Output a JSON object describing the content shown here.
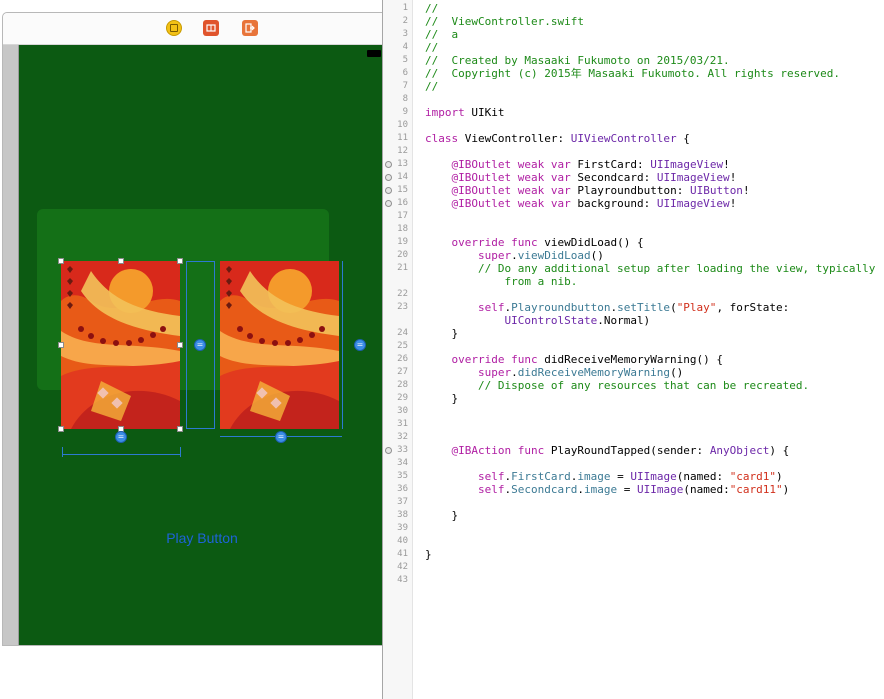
{
  "storyboard": {
    "play_button_label": "Play Button"
  },
  "editor": {
    "lines": [
      {
        "n": "1",
        "tokens": [
          [
            "c",
            "//"
          ]
        ]
      },
      {
        "n": "2",
        "tokens": [
          [
            "c",
            "//  ViewController.swift"
          ]
        ]
      },
      {
        "n": "3",
        "tokens": [
          [
            "c",
            "//  a"
          ]
        ]
      },
      {
        "n": "4",
        "tokens": [
          [
            "c",
            "//"
          ]
        ]
      },
      {
        "n": "5",
        "tokens": [
          [
            "c",
            "//  Created by Masaaki Fukumoto on 2015/03/21."
          ]
        ]
      },
      {
        "n": "6",
        "tokens": [
          [
            "c",
            "//  Copyright (c) 2015年 Masaaki Fukumoto. All rights reserved."
          ]
        ]
      },
      {
        "n": "7",
        "tokens": [
          [
            "c",
            "//"
          ]
        ]
      },
      {
        "n": "8",
        "tokens": []
      },
      {
        "n": "9",
        "tokens": [
          [
            "k",
            "import"
          ],
          [
            "p",
            " UIKit"
          ]
        ]
      },
      {
        "n": "10",
        "tokens": []
      },
      {
        "n": "11",
        "tokens": [
          [
            "k",
            "class"
          ],
          [
            "p",
            " ViewController: "
          ],
          [
            "t",
            "UIViewController"
          ],
          [
            "p",
            " {"
          ]
        ]
      },
      {
        "n": "12",
        "tokens": []
      },
      {
        "n": "13",
        "conn": true,
        "tokens": [
          [
            "p",
            "    "
          ],
          [
            "k",
            "@IBOutlet"
          ],
          [
            "p",
            " "
          ],
          [
            "k",
            "weak"
          ],
          [
            "p",
            " "
          ],
          [
            "k",
            "var"
          ],
          [
            "p",
            " FirstCard: "
          ],
          [
            "t",
            "UIImageView"
          ],
          [
            "p",
            "!"
          ]
        ]
      },
      {
        "n": "14",
        "conn": true,
        "tokens": [
          [
            "p",
            "    "
          ],
          [
            "k",
            "@IBOutlet"
          ],
          [
            "p",
            " "
          ],
          [
            "k",
            "weak"
          ],
          [
            "p",
            " "
          ],
          [
            "k",
            "var"
          ],
          [
            "p",
            " Secondcard: "
          ],
          [
            "t",
            "UIImageView"
          ],
          [
            "p",
            "!"
          ]
        ]
      },
      {
        "n": "15",
        "conn": true,
        "tokens": [
          [
            "p",
            "    "
          ],
          [
            "k",
            "@IBOutlet"
          ],
          [
            "p",
            " "
          ],
          [
            "k",
            "weak"
          ],
          [
            "p",
            " "
          ],
          [
            "k",
            "var"
          ],
          [
            "p",
            " Playroundbutton: "
          ],
          [
            "t",
            "UIButton"
          ],
          [
            "p",
            "!"
          ]
        ]
      },
      {
        "n": "16",
        "conn": true,
        "tokens": [
          [
            "p",
            "    "
          ],
          [
            "k",
            "@IBOutlet"
          ],
          [
            "p",
            " "
          ],
          [
            "k",
            "weak"
          ],
          [
            "p",
            " "
          ],
          [
            "k",
            "var"
          ],
          [
            "p",
            " background: "
          ],
          [
            "t",
            "UIImageView"
          ],
          [
            "p",
            "!"
          ]
        ]
      },
      {
        "n": "17",
        "tokens": []
      },
      {
        "n": "18",
        "tokens": []
      },
      {
        "n": "19",
        "tokens": [
          [
            "p",
            "    "
          ],
          [
            "k",
            "override"
          ],
          [
            "p",
            " "
          ],
          [
            "k",
            "func"
          ],
          [
            "p",
            " viewDidLoad() {"
          ]
        ]
      },
      {
        "n": "20",
        "tokens": [
          [
            "p",
            "        "
          ],
          [
            "k",
            "super"
          ],
          [
            "p",
            "."
          ],
          [
            "m",
            "viewDidLoad"
          ],
          [
            "p",
            "()"
          ]
        ]
      },
      {
        "n": "21",
        "tokens": [
          [
            "p",
            "        "
          ],
          [
            "c",
            "// Do any additional setup after loading the view, typically"
          ]
        ]
      },
      {
        "n": "",
        "tokens": [
          [
            "p",
            "            "
          ],
          [
            "c",
            "from a nib."
          ]
        ]
      },
      {
        "n": "22",
        "tokens": []
      },
      {
        "n": "23",
        "tokens": [
          [
            "p",
            "        "
          ],
          [
            "k",
            "self"
          ],
          [
            "p",
            "."
          ],
          [
            "m",
            "Playroundbutton"
          ],
          [
            "p",
            "."
          ],
          [
            "m",
            "setTitle"
          ],
          [
            "p",
            "("
          ],
          [
            "s",
            "\"Play\""
          ],
          [
            "p",
            ", forState:"
          ]
        ]
      },
      {
        "n": "",
        "tokens": [
          [
            "p",
            "            "
          ],
          [
            "t",
            "UIControlState"
          ],
          [
            "p",
            ".Normal)"
          ]
        ]
      },
      {
        "n": "24",
        "tokens": [
          [
            "p",
            "    }"
          ]
        ]
      },
      {
        "n": "25",
        "tokens": []
      },
      {
        "n": "26",
        "tokens": [
          [
            "p",
            "    "
          ],
          [
            "k",
            "override"
          ],
          [
            "p",
            " "
          ],
          [
            "k",
            "func"
          ],
          [
            "p",
            " didReceiveMemoryWarning() {"
          ]
        ]
      },
      {
        "n": "27",
        "tokens": [
          [
            "p",
            "        "
          ],
          [
            "k",
            "super"
          ],
          [
            "p",
            "."
          ],
          [
            "m",
            "didReceiveMemoryWarning"
          ],
          [
            "p",
            "()"
          ]
        ]
      },
      {
        "n": "28",
        "tokens": [
          [
            "p",
            "        "
          ],
          [
            "c",
            "// Dispose of any resources that can be recreated."
          ]
        ]
      },
      {
        "n": "29",
        "tokens": [
          [
            "p",
            "    }"
          ]
        ]
      },
      {
        "n": "30",
        "tokens": []
      },
      {
        "n": "31",
        "tokens": []
      },
      {
        "n": "32",
        "tokens": []
      },
      {
        "n": "33",
        "conn": true,
        "tokens": [
          [
            "p",
            "    "
          ],
          [
            "k",
            "@IBAction"
          ],
          [
            "p",
            " "
          ],
          [
            "k",
            "func"
          ],
          [
            "p",
            " PlayRoundTapped(sender: "
          ],
          [
            "t",
            "AnyObject"
          ],
          [
            "p",
            ") {"
          ]
        ]
      },
      {
        "n": "34",
        "tokens": []
      },
      {
        "n": "35",
        "tokens": [
          [
            "p",
            "        "
          ],
          [
            "k",
            "self"
          ],
          [
            "p",
            "."
          ],
          [
            "m",
            "FirstCard"
          ],
          [
            "p",
            "."
          ],
          [
            "m",
            "image"
          ],
          [
            "p",
            " = "
          ],
          [
            "t",
            "UIImage"
          ],
          [
            "p",
            "(named: "
          ],
          [
            "s",
            "\"card1\""
          ],
          [
            "p",
            ")"
          ]
        ]
      },
      {
        "n": "36",
        "tokens": [
          [
            "p",
            "        "
          ],
          [
            "k",
            "self"
          ],
          [
            "p",
            "."
          ],
          [
            "m",
            "Secondcard"
          ],
          [
            "p",
            "."
          ],
          [
            "m",
            "image"
          ],
          [
            "p",
            " = "
          ],
          [
            "t",
            "UIImage"
          ],
          [
            "p",
            "(named:"
          ],
          [
            "s",
            "\"card11\""
          ],
          [
            "p",
            ")"
          ]
        ]
      },
      {
        "n": "37",
        "tokens": []
      },
      {
        "n": "38",
        "tokens": [
          [
            "p",
            "    }"
          ]
        ]
      },
      {
        "n": "39",
        "tokens": []
      },
      {
        "n": "40",
        "tokens": []
      },
      {
        "n": "41",
        "tokens": [
          [
            "p",
            "}"
          ]
        ]
      },
      {
        "n": "42",
        "tokens": []
      },
      {
        "n": "43",
        "tokens": []
      }
    ]
  },
  "colors": {
    "view_background": "#0c5a12",
    "cards_container": "#147017",
    "button_text": "#1e63d8",
    "comment": "#1d8a18",
    "keyword": "#b01ea3",
    "type": "#6c27a8",
    "string": "#d12f1b"
  },
  "icons": [
    "view-controller-icon",
    "first-responder-icon",
    "exit-icon",
    "battery-icon",
    "constraint-icon",
    "outlet-connection-icon"
  ]
}
